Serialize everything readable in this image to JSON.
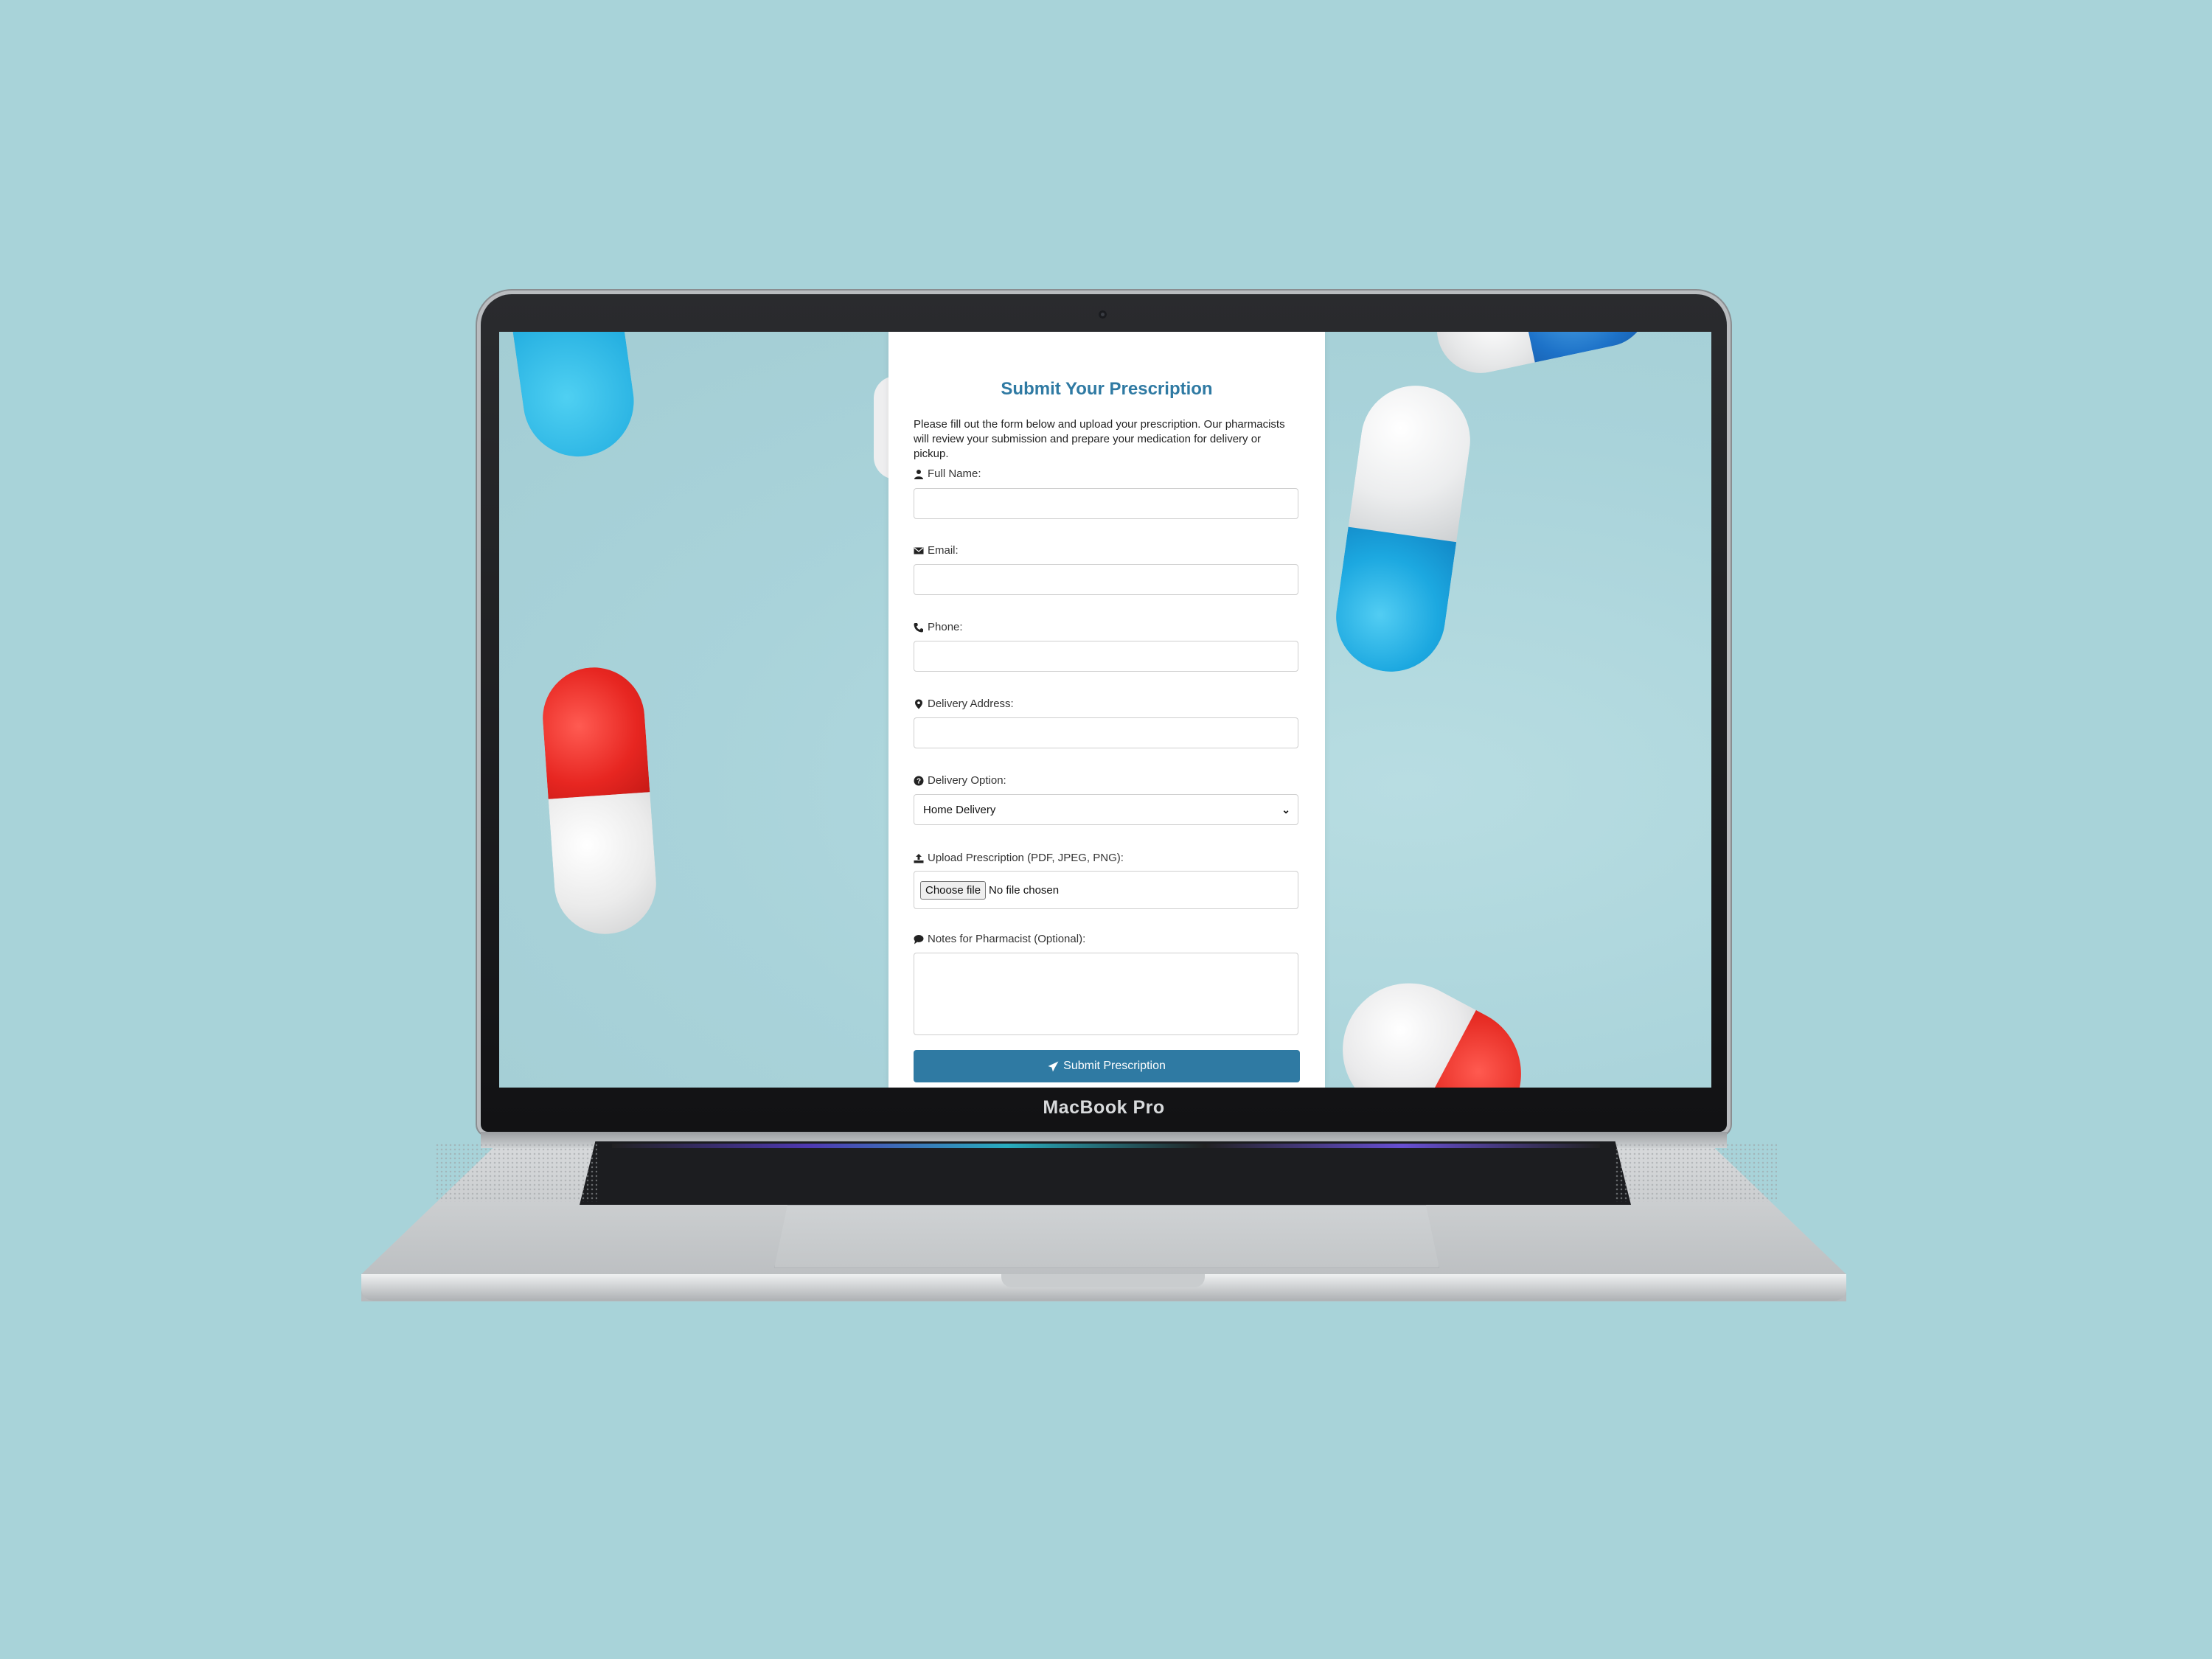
{
  "device": {
    "brand": "MacBook Pro"
  },
  "form": {
    "title": "Submit Your Prescription",
    "intro": "Please fill out the form below and upload your prescription. Our pharmacists will review your submission and prepare your medication for delivery or pickup.",
    "full_name_label": "Full Name:",
    "email_label": "Email:",
    "phone_label": "Phone:",
    "address_label": "Delivery Address:",
    "delivery_option_label": "Delivery Option:",
    "delivery_option_value": "Home Delivery",
    "upload_label": "Upload Prescription (PDF, JPEG, PNG):",
    "choose_file_label": "Choose file",
    "no_file_text": "No file chosen",
    "notes_label": "Notes for Pharmacist (Optional):",
    "submit_label": "Submit Prescription"
  },
  "colors": {
    "accent": "#2f7aa3",
    "background": "#a8d3d9"
  },
  "icons": [
    "user-icon",
    "envelope-icon",
    "phone-icon",
    "map-marker-icon",
    "question-circle-icon",
    "upload-icon",
    "comment-icon",
    "paper-plane-icon",
    "chevron-down-icon"
  ]
}
